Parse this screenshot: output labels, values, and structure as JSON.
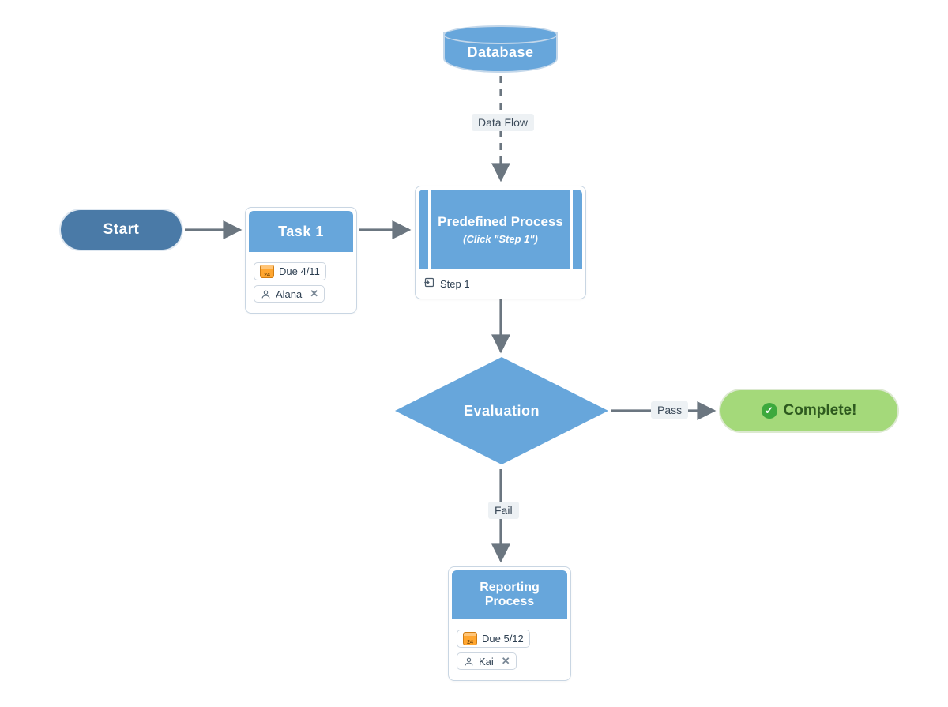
{
  "nodes": {
    "start": {
      "label": "Start"
    },
    "task1": {
      "title": "Task 1",
      "due": "Due 4/11",
      "assignee": "Alana"
    },
    "predefined": {
      "title": "Predefined Process",
      "subtitle": "(Click \"Step 1\")",
      "step_label": "Step 1"
    },
    "database": {
      "label": "Database"
    },
    "evaluation": {
      "label": "Evaluation"
    },
    "complete": {
      "label": "Complete!"
    },
    "reporting": {
      "title_line1": "Reporting",
      "title_line2": "Process",
      "due": "Due 5/12",
      "assignee": "Kai"
    }
  },
  "edges": {
    "data_flow": "Data Flow",
    "pass": "Pass",
    "fail": "Fail"
  },
  "colors": {
    "node_fill": "#67a6db",
    "start_fill": "#4a7aa7",
    "complete_fill": "#a4d97a",
    "arrow": "#6b7680"
  }
}
